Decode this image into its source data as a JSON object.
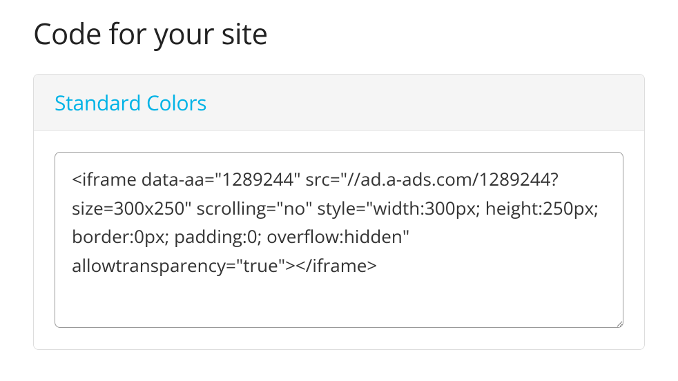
{
  "page": {
    "title": "Code for your site"
  },
  "panel": {
    "header": "Standard Colors",
    "code": "<iframe data-aa=\"1289244\" src=\"//ad.a-ads.com/1289244?size=300x250\" scrolling=\"no\" style=\"width:300px; height:250px; border:0px; padding:0; overflow:hidden\" allowtransparency=\"true\"></iframe>"
  }
}
